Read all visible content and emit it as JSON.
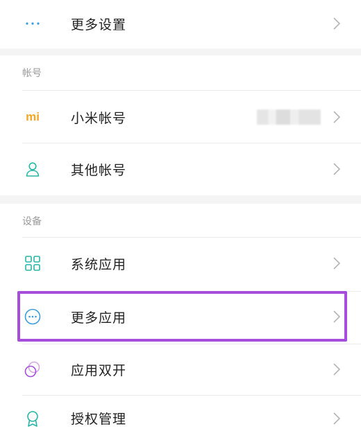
{
  "rows": {
    "more_settings": {
      "label": "更多设置",
      "icon": "more-dots-icon"
    },
    "mi_account": {
      "label": "小米帐号",
      "icon": "mi-logo-icon"
    },
    "other_accounts": {
      "label": "其他帐号",
      "icon": "person-icon"
    },
    "system_apps": {
      "label": "系统应用",
      "icon": "grid-icon"
    },
    "more_apps": {
      "label": "更多应用",
      "icon": "more-circle-icon"
    },
    "dual_apps": {
      "label": "应用双开",
      "icon": "dual-circles-icon"
    },
    "permissions": {
      "label": "授权管理",
      "icon": "badge-icon"
    }
  },
  "sections": {
    "account": "帐号",
    "device": "设备"
  },
  "mi_logo_text": "mi",
  "colors": {
    "accent_highlight": "#a64ddb",
    "mi_orange": "#f5a623",
    "icon_teal": "#27b5a6",
    "icon_blue": "#3a9ddb"
  }
}
